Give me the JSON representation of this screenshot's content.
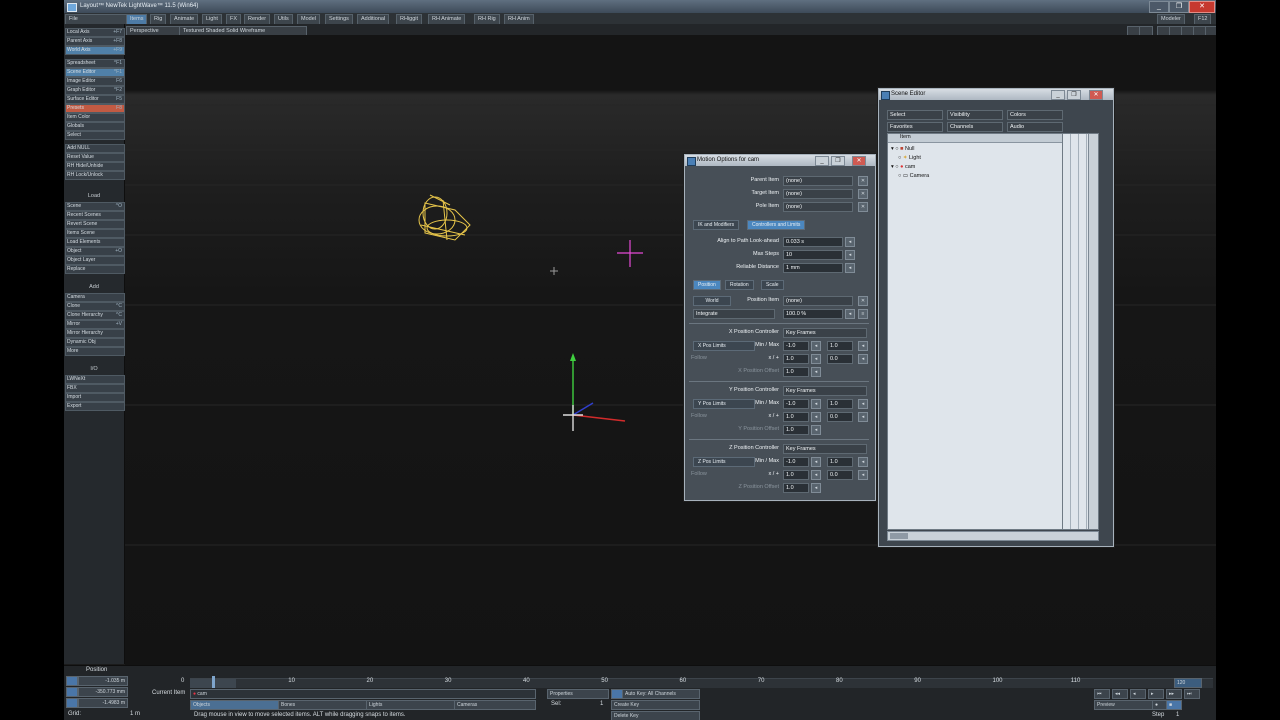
{
  "window": {
    "title": "Layout™ NewTek LightWave™ 11.5 (Win64)",
    "min": "_",
    "max": "❐",
    "close": "✕",
    "right_label": "Modeler",
    "right_key": "F12"
  },
  "menu": {
    "file": "File",
    "tabs": [
      "Items",
      "Rig",
      "Animate",
      "Light",
      "FX",
      "Render",
      "Utils",
      "Model",
      "Settings",
      "Additional",
      "RHiggit",
      "RH Animate",
      "RH Rig",
      "RH Anim"
    ]
  },
  "viewport_bar": {
    "view": "Perspective",
    "shading": "Textured Shaded Solid Wireframe"
  },
  "toolbar": {
    "items": [
      {
        "label": "Local Axis",
        "sc": "+F7"
      },
      {
        "label": "Parent Axis",
        "sc": "+F8"
      },
      {
        "label": "World Axis",
        "sc": "+F9"
      },
      {
        "label": "Spreadsheet",
        "sc": "^F1"
      },
      {
        "label": "Scene Editor",
        "sc": "^F1"
      },
      {
        "label": "Image Editor",
        "sc": "F6"
      },
      {
        "label": "Graph Editor",
        "sc": "^F2"
      },
      {
        "label": "Surface Editor",
        "sc": "F5"
      },
      {
        "label": "Presets",
        "sc": "F8"
      },
      {
        "label": "Item Color",
        "sc": ""
      },
      {
        "label": "Globals",
        "sc": ""
      },
      {
        "label": "Select",
        "sc": ""
      },
      {
        "label": "Add NULL",
        "sc": ""
      },
      {
        "label": "Reset Value",
        "sc": ""
      },
      {
        "label": "RH Hide/Unhide",
        "sc": ""
      },
      {
        "label": "RH Lock/Unlock",
        "sc": ""
      },
      {
        "label": "Load",
        "sc": ""
      },
      {
        "label": "Scene",
        "sc": "^O"
      },
      {
        "label": "Recent Scenes",
        "sc": ""
      },
      {
        "label": "Revert Scene",
        "sc": ""
      },
      {
        "label": "Items Scene",
        "sc": ""
      },
      {
        "label": "Load Elements",
        "sc": ""
      },
      {
        "label": "Object",
        "sc": "+O"
      },
      {
        "label": "Object Layer",
        "sc": ""
      },
      {
        "label": "Replace",
        "sc": ""
      },
      {
        "label": "Add",
        "sc": ""
      },
      {
        "label": "Camera",
        "sc": ""
      },
      {
        "label": "Clone",
        "sc": "^C"
      },
      {
        "label": "Clone Hierarchy",
        "sc": "^C"
      },
      {
        "label": "Mirror",
        "sc": "+V"
      },
      {
        "label": "Mirror Hierarchy",
        "sc": ""
      },
      {
        "label": "Dynamic Obj",
        "sc": ""
      },
      {
        "label": "More",
        "sc": ""
      },
      {
        "label": "I/O",
        "sc": ""
      },
      {
        "label": "LWNeXt",
        "sc": ""
      },
      {
        "label": "FBX",
        "sc": ""
      },
      {
        "label": "Import",
        "sc": ""
      },
      {
        "label": "Export",
        "sc": ""
      }
    ]
  },
  "motion_options": {
    "title": "Motion Options for cam",
    "parent_item_label": "Parent Item",
    "parent_item_value": "(none)",
    "target_item_label": "Target Item",
    "target_item_value": "(none)",
    "pole_item_label": "Pole Item",
    "pole_item_value": "(none)",
    "tab_ik": "IK and Modifiers",
    "tab_ctrl": "Controllers and Limits",
    "align_label": "Align to Path Look-ahead",
    "align_value": "0.033 s",
    "max_steps_label": "Max Steps",
    "max_steps_value": "10",
    "reliable_label": "Reliable Distance",
    "reliable_value": "1 mm",
    "sub_position": "Position",
    "sub_rotation": "Rotation",
    "sub_scale": "Scale",
    "world_btn": "World",
    "position_item_label": "Position Item",
    "position_item_value": "(none)",
    "integrate": "Integrate",
    "percent": "100.0 %",
    "x_ctrl_label": "X Position Controller",
    "x_ctrl_value": "Key Frames",
    "x_limits": "X Pos Limits",
    "y_ctrl_label": "Y Position Controller",
    "y_ctrl_value": "Key Frames",
    "y_limits": "Y Pos Limits",
    "z_ctrl_label": "Z Position Controller",
    "z_ctrl_value": "Key Frames",
    "z_limits": "Z Pos Limits",
    "minmax": "Min / Max",
    "xy": "x / +",
    "follow": "Follow",
    "min_val": "-1.0",
    "max_val": "1.0",
    "f1": "1.0",
    "f2": "0.0",
    "f3": "1.0",
    "xoffset": "X Position Offset",
    "yoffset": "Y Position Offset",
    "zoffset": "Z Position Offset"
  },
  "scene_editor": {
    "title": "Scene Editor",
    "select": "Select",
    "visibility": "Visibility",
    "colors": "Colors",
    "favorites": "Favorites",
    "channels": "Channels",
    "audio": "Audio",
    "col_item": "Item",
    "rows": [
      "Null",
      "Light",
      "cam",
      "Camera"
    ]
  },
  "timeline": {
    "position_label": "Position",
    "x_val": "-1.035 m",
    "y_val": "-350.773 mm",
    "z_val": "-1.4983 m",
    "grid_label": "Grid:",
    "grid_val": "1 m",
    "current_item_label": "Current Item",
    "current_item": "cam",
    "objects": "Objects",
    "bones": "Bones",
    "lights": "Lights",
    "cameras": "Cameras",
    "properties": "Properties",
    "sel_label": "Sel:",
    "sel_val": "1",
    "auto_key": "Auto Key: All Channels",
    "create_key": "Create Key",
    "delete_key": "Delete Key",
    "status": "Drag mouse in view to move selected items. ALT while dragging snaps to items.",
    "preview": "Preview",
    "step_label": "Step",
    "step_val": "1",
    "ticks": [
      "0",
      "10",
      "20",
      "30",
      "40",
      "50",
      "60",
      "70",
      "80",
      "90",
      "100",
      "110",
      "120"
    ],
    "current_frame": "0",
    "end_frame": "120"
  }
}
